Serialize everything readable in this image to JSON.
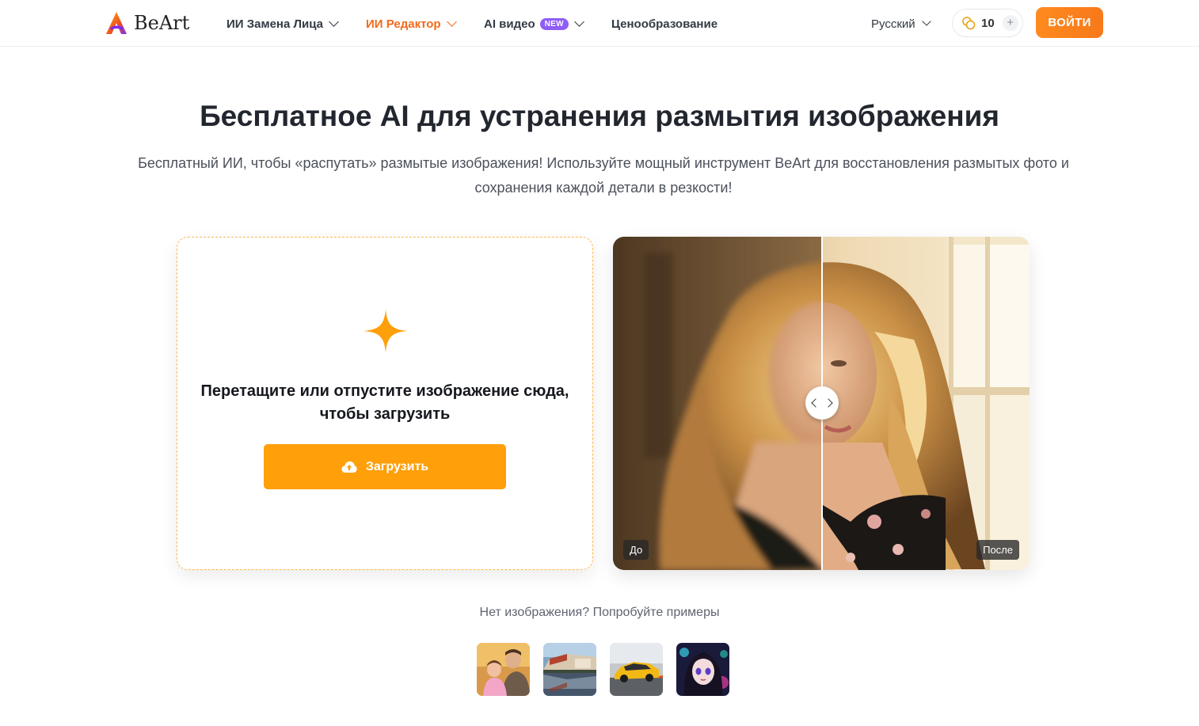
{
  "brand": {
    "name": "BeArt"
  },
  "nav": {
    "items": [
      {
        "label": "ИИ Замена Лица",
        "active": false
      },
      {
        "label": "ИИ Редактор",
        "active": true
      },
      {
        "label": "AI видео",
        "badge": "NEW",
        "active": false
      },
      {
        "label": "Ценообразование",
        "active": false
      }
    ],
    "language": "Русский",
    "credits": "10",
    "credits_add": "+",
    "login": "ВОЙТИ"
  },
  "hero": {
    "title": "Бесплатное AI для устранения размытия изображения",
    "subtitle": "Бесплатный ИИ, чтобы «распутать» размытые изображения! Используйте мощный инструмент BeArt для восстановления размытых фото и сохранения каждой детали в резкости!"
  },
  "upload": {
    "hint": "Перетащите или отпустите изображение сюда, чтобы загрузить",
    "button": "Загрузить"
  },
  "compare": {
    "before_label": "До",
    "after_label": "После",
    "slider_position": 0.5
  },
  "samples": {
    "label": "Нет изображения? Попробуйте примеры",
    "items": [
      "family-photo",
      "street-reflection",
      "yellow-sports-car",
      "anime-girl"
    ]
  },
  "colors": {
    "accent": "#ff9f0a",
    "active_nav": "#f26a1b",
    "badge": "#8e5cf6",
    "login": "#f7791a"
  }
}
